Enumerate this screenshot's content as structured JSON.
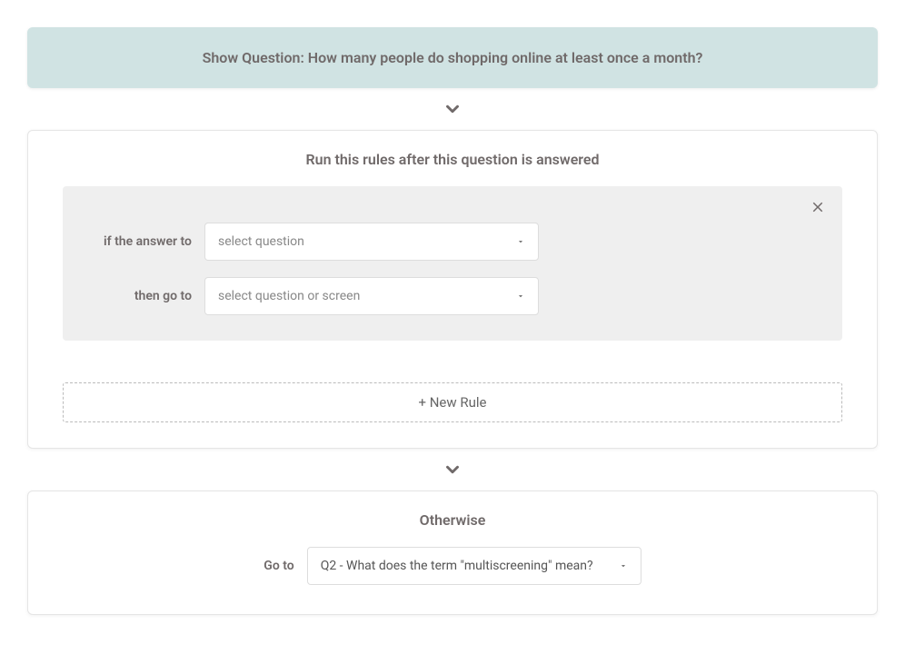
{
  "banner": {
    "text": "Show Question: How many people do shopping online at least once a month?"
  },
  "rules_card": {
    "title": "Run this rules after this question is answered",
    "rule": {
      "if_label": "if the answer to",
      "if_placeholder": "select question",
      "then_label": "then go to",
      "then_placeholder": "select question or screen"
    },
    "new_rule_label": "+ New Rule"
  },
  "otherwise_card": {
    "title": "Otherwise",
    "goto_label": "Go to",
    "goto_value": "Q2 - What does the term \"multiscreening\" mean?"
  }
}
